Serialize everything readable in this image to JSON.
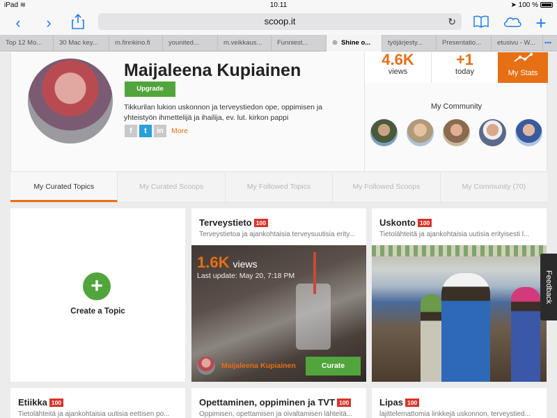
{
  "status": {
    "device": "iPad",
    "time": "10.11",
    "battery": "100 %"
  },
  "browser": {
    "url": "scoop.it",
    "tabs": [
      "Top 12 Mo...",
      "30 Mac key...",
      "m.finnkino.fi",
      "younited...",
      "m.veikkaus...",
      "Funniest...",
      "Shine o...",
      "työjärjesty...",
      "Presentatio...",
      "etusivu - W..."
    ],
    "active_tab": "Shine o..."
  },
  "profile": {
    "name": "Maijaleena Kupiainen",
    "upgrade_label": "Upgrade",
    "bio": "Tikkurilan lukion uskonnon ja terveystiedon ope, oppimisen ja yhteistyön ihmettelijä ja ihailija, ev. lut. kirkon pappi",
    "more_label": "More"
  },
  "stats": {
    "views_num": "4.6K",
    "views_label": "views",
    "today_num": "+1",
    "today_label": "today",
    "mystats_label": "My Stats"
  },
  "community": {
    "title": "My Community",
    "member_colors": [
      "#4a5a3a",
      "#b09a7a",
      "#8a6a50",
      "#5a6a8a",
      "#3a5aa0"
    ]
  },
  "topic_tabs": [
    "My Curated Topics",
    "My Curated Scoops",
    "My Followed Topics",
    "My Followed Scoops",
    "My Community (70)"
  ],
  "create_label": "Create a Topic",
  "topics": [
    {
      "title": "Terveystieto",
      "badge": "100",
      "desc": "Terveystietoa ja ajankohtaisia terveysuutisia erity...",
      "views_num": "1.6K",
      "views_word": "views",
      "last_update": "Last update: May 20, 7:18 PM",
      "curator": "Maijaleena Kupiainen",
      "curate_label": "Curate"
    },
    {
      "title": "Uskonto",
      "badge": "100",
      "desc": "Tietolähteitä ja ajankohtaisia uutisia erityisesti l..."
    }
  ],
  "bottom_topics": [
    {
      "title": "Etiikka",
      "badge": "100",
      "desc": "Tietolähteitä ja ajankohtaisia uutisia eettisen po..."
    },
    {
      "title": "Opettaminen, oppiminen ja TVT",
      "badge": "100",
      "desc": "Oppimisen, opettamisen ja oivaltamisen lähteitä..."
    },
    {
      "title": "Lipas",
      "badge": "100",
      "desc": "lajittelemattomia linkkejä uskonnon, terveystied..."
    }
  ],
  "feedback_label": "Feedback"
}
